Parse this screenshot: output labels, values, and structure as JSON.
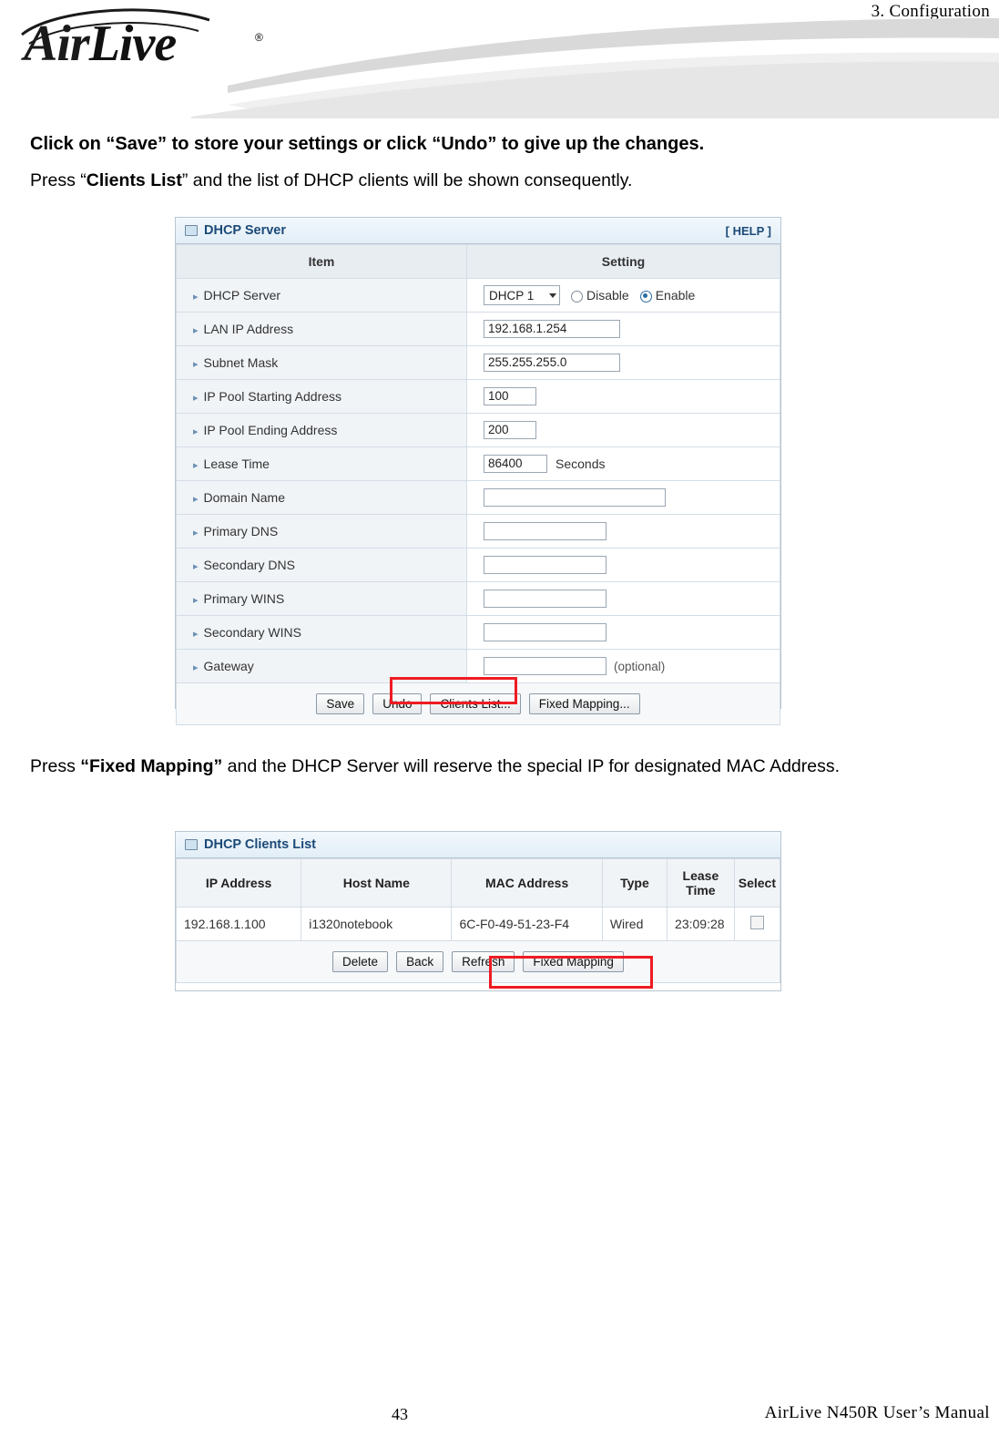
{
  "header": {
    "chapter": "3.  Configuration",
    "logo_air": "Air",
    "logo_live": "Live",
    "logo_reg": "®"
  },
  "body": {
    "line1": "Click on “Save” to store your settings or click “Undo” to give up the changes.",
    "line2_pre": "Press “",
    "line2_bold": "Clients List",
    "line2_post": "” and the list of DHCP clients will be shown consequently.",
    "line3_pre": "Press ",
    "line3_bold": "“Fixed Mapping”",
    "line3_post": " and the DHCP Server will reserve the special IP for designated MAC Address."
  },
  "dhcp_server_panel": {
    "title": "DHCP Server",
    "help": "[ HELP ]",
    "col_item": "Item",
    "col_setting": "Setting",
    "rows": [
      {
        "item": "DHCP Server",
        "type": "select-radio",
        "select_value": "DHCP 1",
        "radio_off": "Disable",
        "radio_on": "Enable"
      },
      {
        "item": "LAN IP Address",
        "type": "text",
        "value": "192.168.1.254"
      },
      {
        "item": "Subnet Mask",
        "type": "text",
        "value": "255.255.255.0"
      },
      {
        "item": "IP Pool Starting Address",
        "type": "text-small",
        "value": "100"
      },
      {
        "item": "IP Pool Ending Address",
        "type": "text-small",
        "value": "200"
      },
      {
        "item": "Lease Time",
        "type": "text-unit",
        "value": "86400",
        "unit": "Seconds"
      },
      {
        "item": "Domain Name",
        "type": "text-wide",
        "value": ""
      },
      {
        "item": "Primary DNS",
        "type": "text",
        "value": ""
      },
      {
        "item": "Secondary DNS",
        "type": "text",
        "value": ""
      },
      {
        "item": "Primary WINS",
        "type": "text",
        "value": ""
      },
      {
        "item": "Secondary WINS",
        "type": "text",
        "value": ""
      },
      {
        "item": "Gateway",
        "type": "text-optional",
        "value": "",
        "note": "(optional)"
      }
    ],
    "buttons": [
      "Save",
      "Undo",
      "Clients List...",
      "Fixed Mapping..."
    ]
  },
  "dhcp_clients_panel": {
    "title": "DHCP Clients List",
    "columns": [
      "IP Address",
      "Host Name",
      "MAC Address",
      "Type",
      "Lease Time",
      "Select"
    ],
    "lease_time_line1": "Lease",
    "lease_time_line2": "Time",
    "rows": [
      {
        "ip": "192.168.1.100",
        "host": "i1320notebook",
        "mac": "6C-F0-49-51-23-F4",
        "type": "Wired",
        "lease": "23:09:28"
      }
    ],
    "buttons": [
      "Delete",
      "Back",
      "Refresh",
      "Fixed Mapping"
    ]
  },
  "footer": {
    "page_number": "43",
    "manual": "AirLive  N450R  User’s  Manual"
  },
  "colors": {
    "highlight": "#ee1c22",
    "panel_title_text": "#1b4a77"
  }
}
